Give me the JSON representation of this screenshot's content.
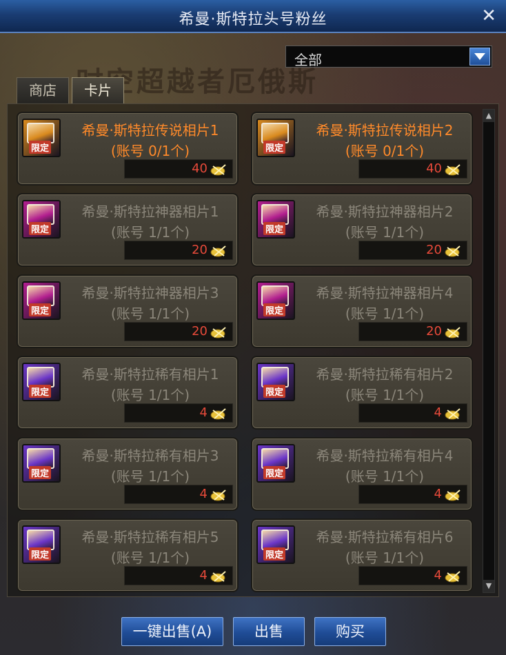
{
  "window": {
    "title": "希曼·斯特拉头号粉丝",
    "close_label": "✕"
  },
  "banner_text": "时空超越者厄俄斯",
  "filter": {
    "selected": "全部"
  },
  "tabs": [
    {
      "label": "商店",
      "active": false
    },
    {
      "label": "卡片",
      "active": true
    }
  ],
  "items": [
    {
      "name": "希曼·斯特拉传说相片1",
      "limit": "(账号 0/1个)",
      "price": "40",
      "available": true,
      "badge": "限定",
      "color": "#d98a1e"
    },
    {
      "name": "希曼·斯特拉传说相片2",
      "limit": "(账号 0/1个)",
      "price": "40",
      "available": true,
      "badge": "限定",
      "color": "#d98a1e"
    },
    {
      "name": "希曼·斯特拉神器相片1",
      "limit": "(账号 1/1个)",
      "price": "20",
      "available": false,
      "badge": "限定",
      "color": "#b21e8f"
    },
    {
      "name": "希曼·斯特拉神器相片2",
      "limit": "(账号 1/1个)",
      "price": "20",
      "available": false,
      "badge": "限定",
      "color": "#b21e8f"
    },
    {
      "name": "希曼·斯特拉神器相片3",
      "limit": "(账号 1/1个)",
      "price": "20",
      "available": false,
      "badge": "限定",
      "color": "#b21e8f"
    },
    {
      "name": "希曼·斯特拉神器相片4",
      "limit": "(账号 1/1个)",
      "price": "20",
      "available": false,
      "badge": "限定",
      "color": "#b21e8f"
    },
    {
      "name": "希曼·斯特拉稀有相片1",
      "limit": "(账号 1/1个)",
      "price": "4",
      "available": false,
      "badge": "限定",
      "color": "#6b36c8"
    },
    {
      "name": "希曼·斯特拉稀有相片2",
      "limit": "(账号 1/1个)",
      "price": "4",
      "available": false,
      "badge": "限定",
      "color": "#6b36c8"
    },
    {
      "name": "希曼·斯特拉稀有相片3",
      "limit": "(账号 1/1个)",
      "price": "4",
      "available": false,
      "badge": "限定",
      "color": "#6b36c8"
    },
    {
      "name": "希曼·斯特拉稀有相片4",
      "limit": "(账号 1/1个)",
      "price": "4",
      "available": false,
      "badge": "限定",
      "color": "#6b36c8"
    },
    {
      "name": "希曼·斯特拉稀有相片5",
      "limit": "(账号 1/1个)",
      "price": "4",
      "available": false,
      "badge": "限定",
      "color": "#6b36c8"
    },
    {
      "name": "希曼·斯特拉稀有相片6",
      "limit": "(账号 1/1个)",
      "price": "4",
      "available": false,
      "badge": "限定",
      "color": "#6b36c8"
    }
  ],
  "buttons": {
    "sell_all": "一键出售(A)",
    "sell": "出售",
    "buy": "购买"
  }
}
